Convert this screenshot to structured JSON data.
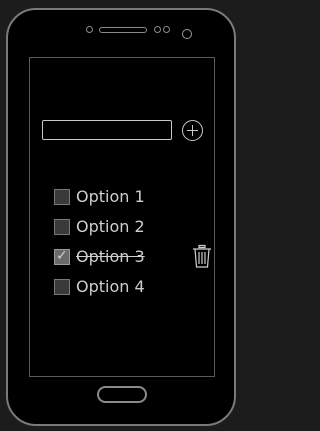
{
  "new_item": {
    "value": "",
    "placeholder": ""
  },
  "add_icon": "plus-circle-icon",
  "todo": {
    "items": [
      {
        "label": "Option 1",
        "checked": false
      },
      {
        "label": "Option 2",
        "checked": false
      },
      {
        "label": "Option 3",
        "checked": true
      },
      {
        "label": "Option 4",
        "checked": false
      }
    ],
    "check_glyph": "✓"
  },
  "trash_icon": "trash-icon",
  "colors": {
    "background": "#1c1c1c",
    "screen": "#000000",
    "text": "#cfcfcf",
    "outline": "#c8c8c8"
  }
}
